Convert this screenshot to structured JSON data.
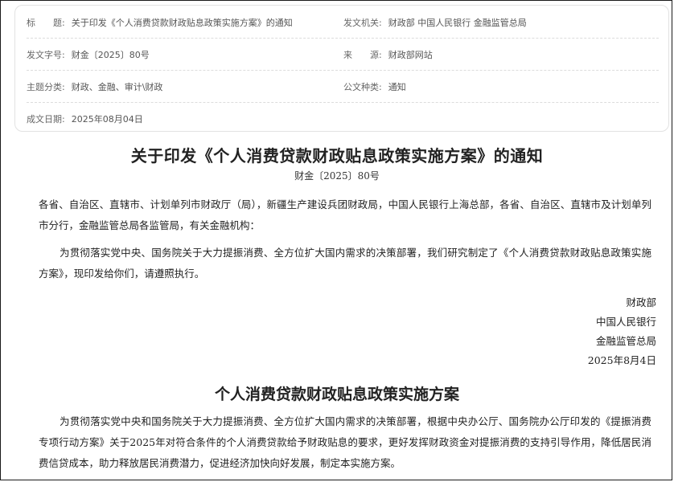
{
  "meta": {
    "title_key": "标　　题:",
    "title_value": "关于印发《个人消费贷款财政贴息政策实施方案》的通知",
    "issuer_key": "发文机关:",
    "issuer_value": "财政部 中国人民银行 金融监管总局",
    "docno_key": "发文字号:",
    "docno_value": "财金〔2025〕80号",
    "source_key": "来　　源:",
    "source_value": "财政部网站",
    "category_key": "主题分类:",
    "category_value": "财政、金融、审计\\财政",
    "type_key": "公文种类:",
    "type_value": "通知",
    "date_key": "成文日期:",
    "date_value": "2025年08月04日"
  },
  "document": {
    "title": "关于印发《个人消费贷款财政贴息政策实施方案》的通知",
    "number": "财金〔2025〕80号",
    "recipients": "各省、自治区、直辖市、计划单列市财政厅（局），新疆生产建设兵团财政局，中国人民银行上海总部，各省、自治区、直辖市及计划单列市分行，金融监管总局各监管局，有关金融机构：",
    "body": "为贯彻落实党中央、国务院关于大力提振消费、全方位扩大国内需求的决策部署，我们研究制定了《个人消费贷款财政贴息政策实施方案》，现印发给你们，请遵照执行。",
    "signatures": [
      "财政部",
      "中国人民银行",
      "金融监管总局"
    ],
    "sign_date": "2025年8月4日"
  },
  "plan": {
    "title": "个人消费贷款财政贴息政策实施方案",
    "intro": "为贯彻落实党中央和国务院关于大力提振消费、全方位扩大国内需求的决策部署，根据中央办公厅、国务院办公厅印发的《提振消费专项行动方案》关于2025年对符合条件的个人消费贷款给予财政贴息的要求，更好发挥财政资金对提振消费的支持引导作用，降低居民消费信贷成本，助力释放居民消费潜力，促进经济加快向好发展，制定本实施方案。"
  }
}
